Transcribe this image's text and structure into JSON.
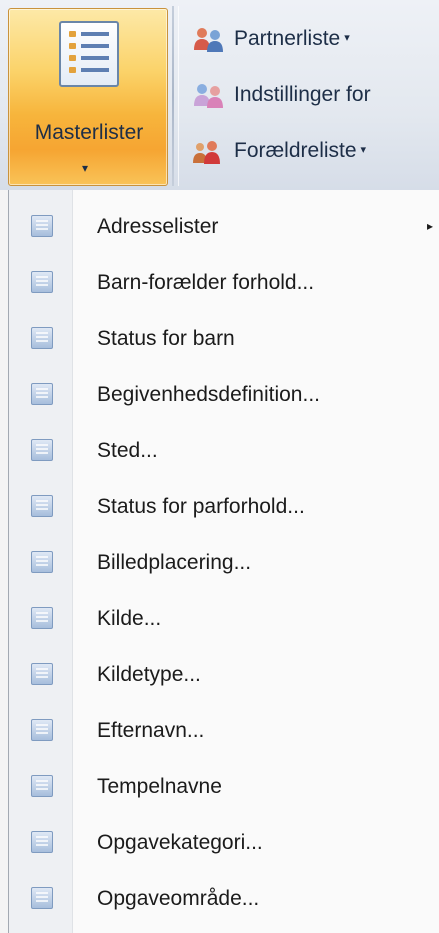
{
  "ribbon": {
    "master_button": {
      "label": "Masterlister",
      "icon": "list-document-icon",
      "chevron": "▾"
    },
    "items": [
      {
        "label": "Partnerliste",
        "icon": "partner-people-icon",
        "has_dropdown": true,
        "chevron": "▾"
      },
      {
        "label": "Indstillinger for",
        "icon": "settings-people-icon",
        "has_dropdown": false,
        "chevron": ""
      },
      {
        "label": "Forældreliste",
        "icon": "parents-people-icon",
        "has_dropdown": true,
        "chevron": "▾"
      }
    ]
  },
  "menu": {
    "submenu_arrow": "▸",
    "items": [
      {
        "label": "Adresselister",
        "icon": "list-icon",
        "has_submenu": true
      },
      {
        "label": "Barn-forælder forhold...",
        "icon": "list-icon",
        "has_submenu": false
      },
      {
        "label": "Status for barn",
        "icon": "list-icon",
        "has_submenu": false
      },
      {
        "label": "Begivenhedsdefinition...",
        "icon": "list-icon",
        "has_submenu": false
      },
      {
        "label": "Sted...",
        "icon": "list-icon",
        "has_submenu": false
      },
      {
        "label": "Status for parforhold...",
        "icon": "list-icon",
        "has_submenu": false
      },
      {
        "label": "Billedplacering...",
        "icon": "list-icon",
        "has_submenu": false
      },
      {
        "label": "Kilde...",
        "icon": "list-icon",
        "has_submenu": false
      },
      {
        "label": "Kildetype...",
        "icon": "list-icon",
        "has_submenu": false
      },
      {
        "label": "Efternavn...",
        "icon": "list-icon",
        "has_submenu": false
      },
      {
        "label": "Tempelnavne",
        "icon": "list-icon",
        "has_submenu": false
      },
      {
        "label": "Opgavekategori...",
        "icon": "list-icon",
        "has_submenu": false
      },
      {
        "label": "Opgaveområde...",
        "icon": "list-icon",
        "has_submenu": false
      }
    ]
  },
  "colors": {
    "master_button_highlight": "#f7b53c",
    "ribbon_background": "#e3e8ef",
    "menu_background": "#fafafa",
    "text": "#1b1b1b"
  }
}
